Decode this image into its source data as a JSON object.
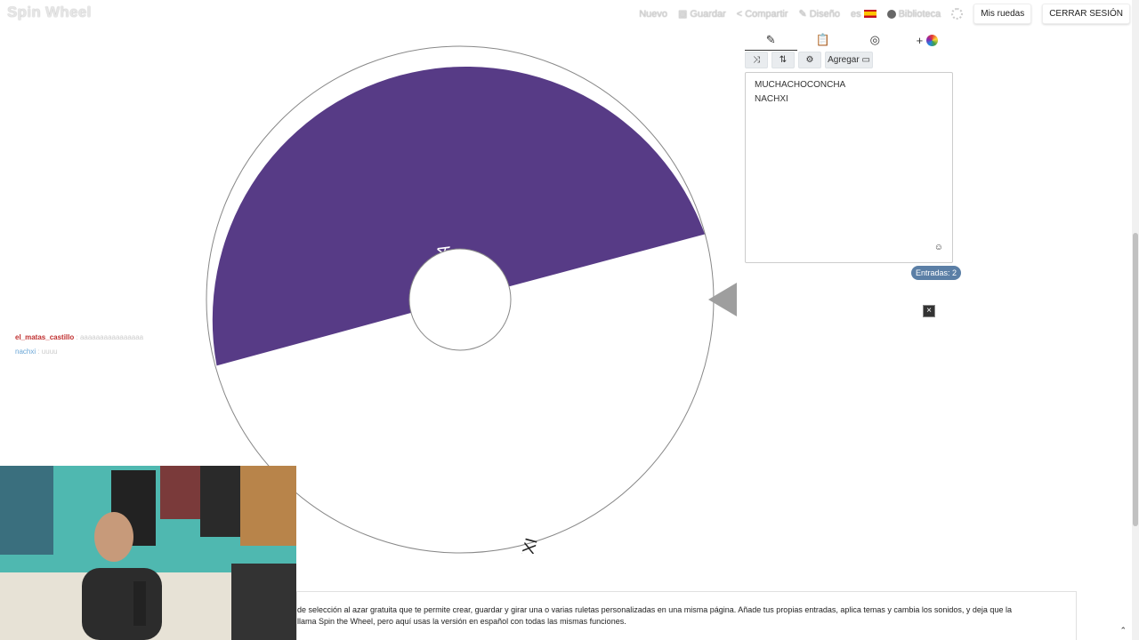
{
  "app": {
    "logo": "Spin Wheel"
  },
  "nav": {
    "new": "Nuevo",
    "save": "Guardar",
    "share": "Compartir",
    "design": "Diseño",
    "lang": "es",
    "library": "Biblioteca",
    "my_wheels": "Mis ruedas",
    "logout": "CERRAR SESIÓN"
  },
  "wheel": {
    "segments": [
      {
        "label": "MUCHACHOCONCHA",
        "color": "#573b86",
        "text_color": "#ffffff"
      },
      {
        "label": "NACHXI",
        "color": "#ffffff",
        "text_color": "#222222"
      }
    ],
    "pointer_color": "#9e9e9e"
  },
  "panel": {
    "tabs": [
      "edit-icon",
      "clipboard-icon",
      "hidden-icon",
      "add-color-icon"
    ],
    "add_button": "Agregar",
    "entries": [
      "MUCHACHOCONCHA",
      "NACHXI"
    ],
    "entry_count": "Entradas: 2"
  },
  "chat": [
    {
      "user": "el_matas_castillo",
      "message": "aaaaaaaaaaaaaaaa"
    },
    {
      "user": "nachxi",
      "message": "uuuu"
    }
  ],
  "description": {
    "line1": "de selección al azar gratuita que te permite crear, guardar y girar una o varias ruletas personalizadas en una misma página. Añade tus propias entradas, aplica temas y cambia los sonidos, y deja que la",
    "line2": "llama Spin the Wheel, pero aquí usas la versión en español con todas las mismas funciones."
  }
}
